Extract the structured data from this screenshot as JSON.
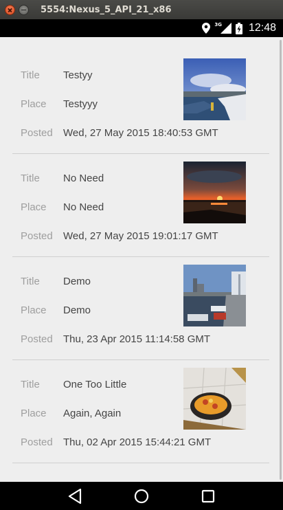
{
  "window": {
    "title": "5554:Nexus_5_API_21_x86"
  },
  "status_bar": {
    "time": "12:48",
    "network": "3G"
  },
  "labels": {
    "title": "Title",
    "place": "Place",
    "posted": "Posted"
  },
  "items": [
    {
      "title": "Testyy",
      "place": "Testyyy",
      "posted": "Wed, 27 May 2015 18:40:53 GMT",
      "photo": "harbor-photo"
    },
    {
      "title": "No Need",
      "place": "No Need",
      "posted": "Wed, 27 May 2015 19:01:17 GMT",
      "photo": "sunset-photo"
    },
    {
      "title": "Demo",
      "place": "Demo",
      "posted": "Thu, 23 Apr 2015 11:14:58 GMT",
      "photo": "river-city-photo"
    },
    {
      "title": "One Too Little",
      "place": "Again, Again",
      "posted": "Thu, 02 Apr 2015 15:44:21 GMT",
      "photo": "food-plate-photo"
    }
  ],
  "nav": {
    "back": "back-icon",
    "home": "home-icon",
    "recents": "recents-icon"
  }
}
